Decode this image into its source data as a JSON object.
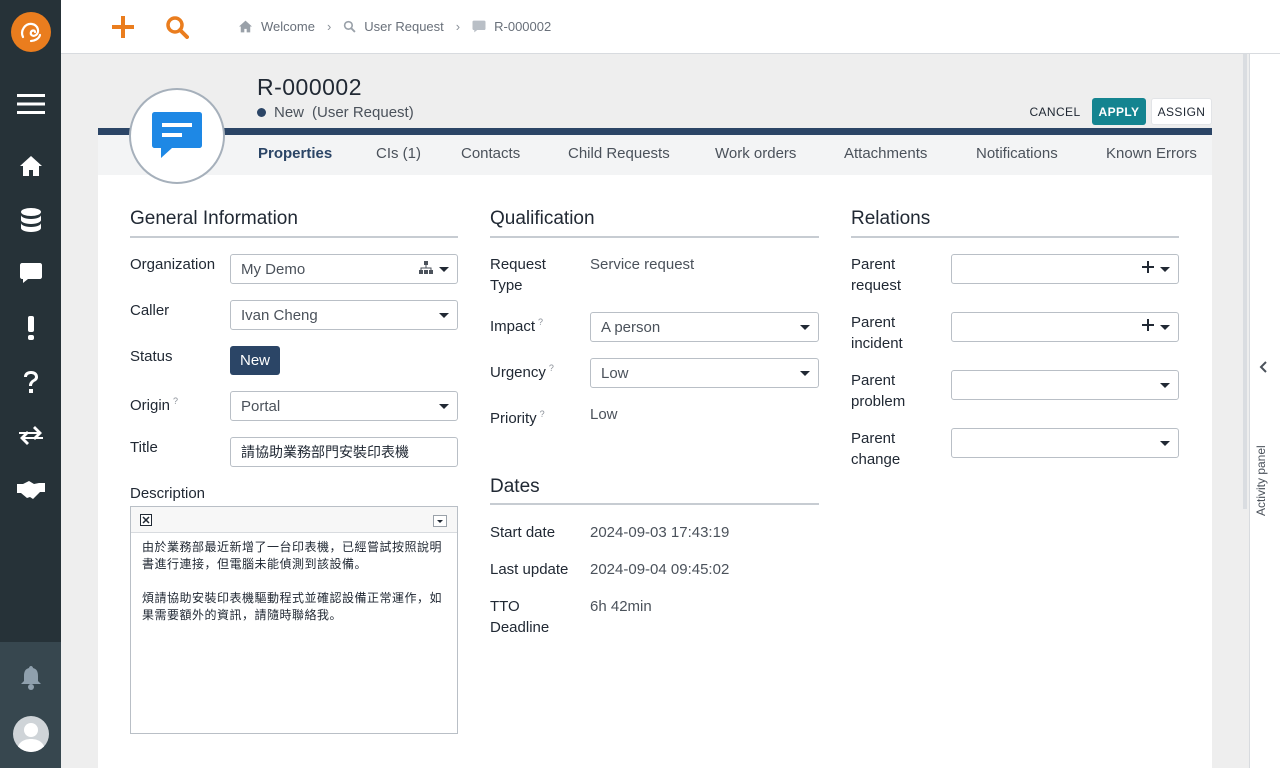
{
  "breadcrumb": [
    "Welcome",
    "User Request",
    "R-000002"
  ],
  "object": {
    "ref": "R-000002",
    "status": "New",
    "class": "(User Request)"
  },
  "actions": {
    "cancel": "CANCEL",
    "apply": "APPLY",
    "assign": "ASSIGN"
  },
  "tabs": [
    "Properties",
    "CIs (1)",
    "Contacts",
    "Child Requests",
    "Work orders",
    "Attachments",
    "Notifications",
    "Known Errors"
  ],
  "general": {
    "title": "General Information",
    "organization_label": "Organization",
    "organization_value": "My Demo",
    "caller_label": "Caller",
    "caller_value": "Ivan Cheng",
    "status_label": "Status",
    "status_value": "New",
    "origin_label": "Origin",
    "origin_value": "Portal",
    "title_label": "Title",
    "title_value": "請協助業務部門安裝印表機",
    "description_label": "Description",
    "description_value": "由於業務部最近新增了一台印表機，已經嘗試按照說明書進行連接，但電腦未能偵測到該設備。\n\n煩請協助安裝印表機驅動程式並確認設備正常運作，如果需要額外的資訊，請隨時聯絡我。"
  },
  "qualification": {
    "title": "Qualification",
    "request_type_label1": "Request",
    "request_type_label2": "Type",
    "request_type_value": "Service request",
    "impact_label": "Impact",
    "impact_value": "A person",
    "urgency_label": "Urgency",
    "urgency_value": "Low",
    "priority_label": "Priority",
    "priority_value": "Low"
  },
  "dates": {
    "title": "Dates",
    "start_label": "Start date",
    "start_value": "2024-09-03 17:43:19",
    "update_label": "Last update",
    "update_value": "2024-09-04 09:45:02",
    "tto_label1": "TTO",
    "tto_label2": "Deadline",
    "tto_value": "6h 42min"
  },
  "relations": {
    "title": "Relations",
    "items": [
      {
        "l1": "Parent",
        "l2": "request"
      },
      {
        "l1": "Parent",
        "l2": "incident"
      },
      {
        "l1": "Parent",
        "l2": "problem"
      },
      {
        "l1": "Parent",
        "l2": "change"
      }
    ]
  },
  "activity_panel": "Activity panel",
  "help_marker": "?",
  "colors": {
    "brand": "#ea7d1e",
    "primary": "#2b4566",
    "apply": "#148490",
    "sidebar": "#263238"
  }
}
